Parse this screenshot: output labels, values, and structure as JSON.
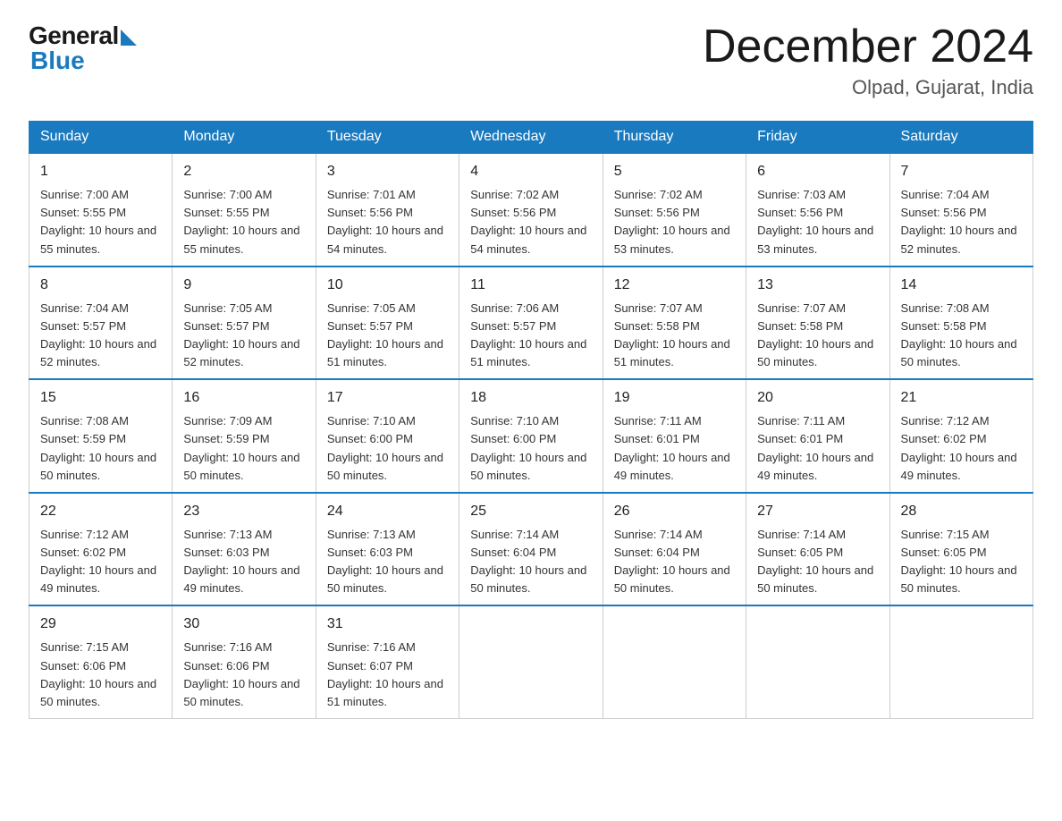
{
  "logo": {
    "general": "General",
    "blue": "Blue"
  },
  "title": "December 2024",
  "location": "Olpad, Gujarat, India",
  "days_of_week": [
    "Sunday",
    "Monday",
    "Tuesday",
    "Wednesday",
    "Thursday",
    "Friday",
    "Saturday"
  ],
  "weeks": [
    [
      {
        "day": "1",
        "sunrise": "7:00 AM",
        "sunset": "5:55 PM",
        "daylight": "10 hours and 55 minutes."
      },
      {
        "day": "2",
        "sunrise": "7:00 AM",
        "sunset": "5:55 PM",
        "daylight": "10 hours and 55 minutes."
      },
      {
        "day": "3",
        "sunrise": "7:01 AM",
        "sunset": "5:56 PM",
        "daylight": "10 hours and 54 minutes."
      },
      {
        "day": "4",
        "sunrise": "7:02 AM",
        "sunset": "5:56 PM",
        "daylight": "10 hours and 54 minutes."
      },
      {
        "day": "5",
        "sunrise": "7:02 AM",
        "sunset": "5:56 PM",
        "daylight": "10 hours and 53 minutes."
      },
      {
        "day": "6",
        "sunrise": "7:03 AM",
        "sunset": "5:56 PM",
        "daylight": "10 hours and 53 minutes."
      },
      {
        "day": "7",
        "sunrise": "7:04 AM",
        "sunset": "5:56 PM",
        "daylight": "10 hours and 52 minutes."
      }
    ],
    [
      {
        "day": "8",
        "sunrise": "7:04 AM",
        "sunset": "5:57 PM",
        "daylight": "10 hours and 52 minutes."
      },
      {
        "day": "9",
        "sunrise": "7:05 AM",
        "sunset": "5:57 PM",
        "daylight": "10 hours and 52 minutes."
      },
      {
        "day": "10",
        "sunrise": "7:05 AM",
        "sunset": "5:57 PM",
        "daylight": "10 hours and 51 minutes."
      },
      {
        "day": "11",
        "sunrise": "7:06 AM",
        "sunset": "5:57 PM",
        "daylight": "10 hours and 51 minutes."
      },
      {
        "day": "12",
        "sunrise": "7:07 AM",
        "sunset": "5:58 PM",
        "daylight": "10 hours and 51 minutes."
      },
      {
        "day": "13",
        "sunrise": "7:07 AM",
        "sunset": "5:58 PM",
        "daylight": "10 hours and 50 minutes."
      },
      {
        "day": "14",
        "sunrise": "7:08 AM",
        "sunset": "5:58 PM",
        "daylight": "10 hours and 50 minutes."
      }
    ],
    [
      {
        "day": "15",
        "sunrise": "7:08 AM",
        "sunset": "5:59 PM",
        "daylight": "10 hours and 50 minutes."
      },
      {
        "day": "16",
        "sunrise": "7:09 AM",
        "sunset": "5:59 PM",
        "daylight": "10 hours and 50 minutes."
      },
      {
        "day": "17",
        "sunrise": "7:10 AM",
        "sunset": "6:00 PM",
        "daylight": "10 hours and 50 minutes."
      },
      {
        "day": "18",
        "sunrise": "7:10 AM",
        "sunset": "6:00 PM",
        "daylight": "10 hours and 50 minutes."
      },
      {
        "day": "19",
        "sunrise": "7:11 AM",
        "sunset": "6:01 PM",
        "daylight": "10 hours and 49 minutes."
      },
      {
        "day": "20",
        "sunrise": "7:11 AM",
        "sunset": "6:01 PM",
        "daylight": "10 hours and 49 minutes."
      },
      {
        "day": "21",
        "sunrise": "7:12 AM",
        "sunset": "6:02 PM",
        "daylight": "10 hours and 49 minutes."
      }
    ],
    [
      {
        "day": "22",
        "sunrise": "7:12 AM",
        "sunset": "6:02 PM",
        "daylight": "10 hours and 49 minutes."
      },
      {
        "day": "23",
        "sunrise": "7:13 AM",
        "sunset": "6:03 PM",
        "daylight": "10 hours and 49 minutes."
      },
      {
        "day": "24",
        "sunrise": "7:13 AM",
        "sunset": "6:03 PM",
        "daylight": "10 hours and 50 minutes."
      },
      {
        "day": "25",
        "sunrise": "7:14 AM",
        "sunset": "6:04 PM",
        "daylight": "10 hours and 50 minutes."
      },
      {
        "day": "26",
        "sunrise": "7:14 AM",
        "sunset": "6:04 PM",
        "daylight": "10 hours and 50 minutes."
      },
      {
        "day": "27",
        "sunrise": "7:14 AM",
        "sunset": "6:05 PM",
        "daylight": "10 hours and 50 minutes."
      },
      {
        "day": "28",
        "sunrise": "7:15 AM",
        "sunset": "6:05 PM",
        "daylight": "10 hours and 50 minutes."
      }
    ],
    [
      {
        "day": "29",
        "sunrise": "7:15 AM",
        "sunset": "6:06 PM",
        "daylight": "10 hours and 50 minutes."
      },
      {
        "day": "30",
        "sunrise": "7:16 AM",
        "sunset": "6:06 PM",
        "daylight": "10 hours and 50 minutes."
      },
      {
        "day": "31",
        "sunrise": "7:16 AM",
        "sunset": "6:07 PM",
        "daylight": "10 hours and 51 minutes."
      },
      {
        "day": "",
        "sunrise": "",
        "sunset": "",
        "daylight": ""
      },
      {
        "day": "",
        "sunrise": "",
        "sunset": "",
        "daylight": ""
      },
      {
        "day": "",
        "sunrise": "",
        "sunset": "",
        "daylight": ""
      },
      {
        "day": "",
        "sunrise": "",
        "sunset": "",
        "daylight": ""
      }
    ]
  ]
}
